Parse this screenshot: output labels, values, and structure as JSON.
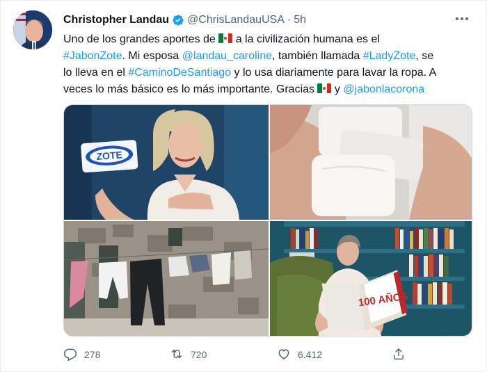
{
  "tweet": {
    "author_name": "Christopher Landau",
    "handle": "@ChrisLandauUSA",
    "separator": "·",
    "time": "5h",
    "text": {
      "l1_a": "Uno de los grandes aportes de ",
      "l1_b": " a la civilización humana es el",
      "l2_tag1": "#JabonZote",
      "l2_a": ". Mi esposa ",
      "l2_mention": "@landau_caroline",
      "l2_b": ", también llamada ",
      "l2_tag2": "#LadyZote",
      "l2_c": ", se",
      "l3_a": "lo lleva en el ",
      "l3_tag": "#CaminoDeSantiago",
      "l3_b": " y lo usa diariamente para lavar la ropa. A",
      "l4_a": "veces lo más básico es lo más importante. Gracias ",
      "l4_b": " y ",
      "l4_mention": "@jabonlacorona"
    },
    "media": {
      "soap_brand": "ZOTE",
      "book_title": "100 AÑOS"
    }
  },
  "actions": {
    "reply_count": "278",
    "retweet_count": "720",
    "like_count": "6.412"
  },
  "colors": {
    "link": "#1d9bf0",
    "secondary_text": "#536471",
    "verified": "#1d9bf0",
    "zote_pink": "#e64f8c"
  },
  "icons": [
    "verified-badge-icon",
    "more-icon",
    "reply-icon",
    "retweet-icon",
    "like-icon",
    "share-icon",
    "mexico-flag-icon"
  ]
}
